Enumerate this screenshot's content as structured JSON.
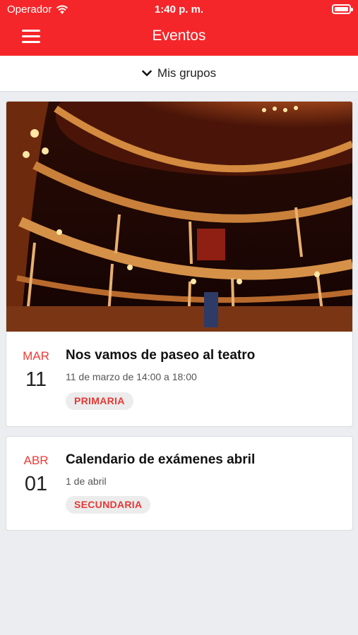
{
  "status_bar": {
    "carrier": "Operador",
    "time": "1:40 p. m."
  },
  "navbar": {
    "title": "Eventos",
    "menu_icon": "hamburger-menu-icon"
  },
  "groups_filter": {
    "label": "Mis grupos",
    "icon": "chevron-down-icon"
  },
  "events": [
    {
      "month": "MAR",
      "day": "11",
      "title": "Nos vamos de paseo al teatro",
      "subtitle": "11 de marzo de 14:00 a 18:00",
      "tag": "PRIMARIA",
      "image": "theater-interior-photo"
    },
    {
      "month": "ABR",
      "day": "01",
      "title": "Calendario de exámenes abril",
      "subtitle": "1 de abril",
      "tag": "SECUNDARIA"
    }
  ],
  "colors": {
    "brand_red": "#f5262a",
    "accent_red": "#e53834",
    "background": "#ebedf0"
  }
}
